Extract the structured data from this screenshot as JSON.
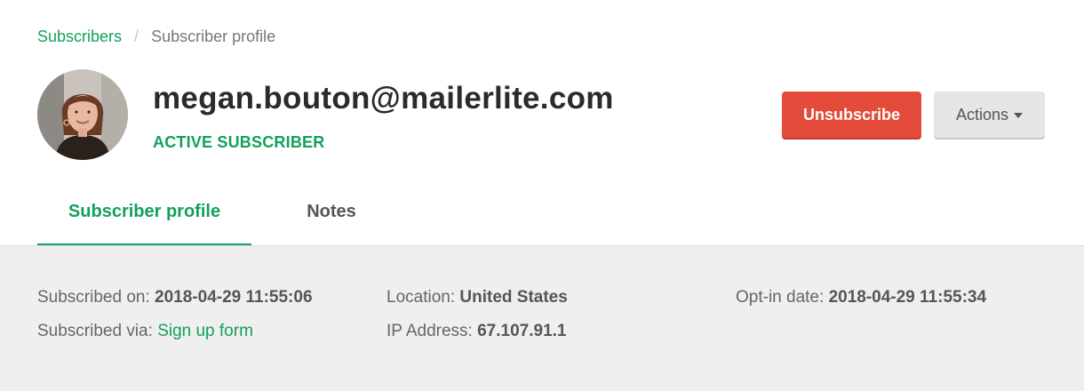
{
  "breadcrumb": {
    "parent": "Subscribers",
    "separator": "/",
    "current": "Subscriber profile"
  },
  "subscriber": {
    "email": "megan.bouton@mailerlite.com",
    "status": "ACTIVE SUBSCRIBER"
  },
  "buttons": {
    "unsubscribe": "Unsubscribe",
    "actions": "Actions"
  },
  "tabs": [
    {
      "label": "Subscriber profile",
      "active": true
    },
    {
      "label": "Notes",
      "active": false
    }
  ],
  "details": {
    "subscribed_on": {
      "label": "Subscribed on:",
      "value": "2018-04-29 11:55:06"
    },
    "subscribed_via": {
      "label": "Subscribed via:",
      "value": "Sign up form"
    },
    "location": {
      "label": "Location:",
      "value": "United States"
    },
    "ip_address": {
      "label": "IP Address:",
      "value": "67.107.91.1"
    },
    "opt_in_date": {
      "label": "Opt-in date:",
      "value": "2018-04-29 11:55:34"
    }
  },
  "colors": {
    "accent_green": "#13a05c",
    "danger_red": "#e44b3b",
    "details_background": "#efefef"
  },
  "icons": {
    "actions_caret": "caret-down-icon"
  }
}
